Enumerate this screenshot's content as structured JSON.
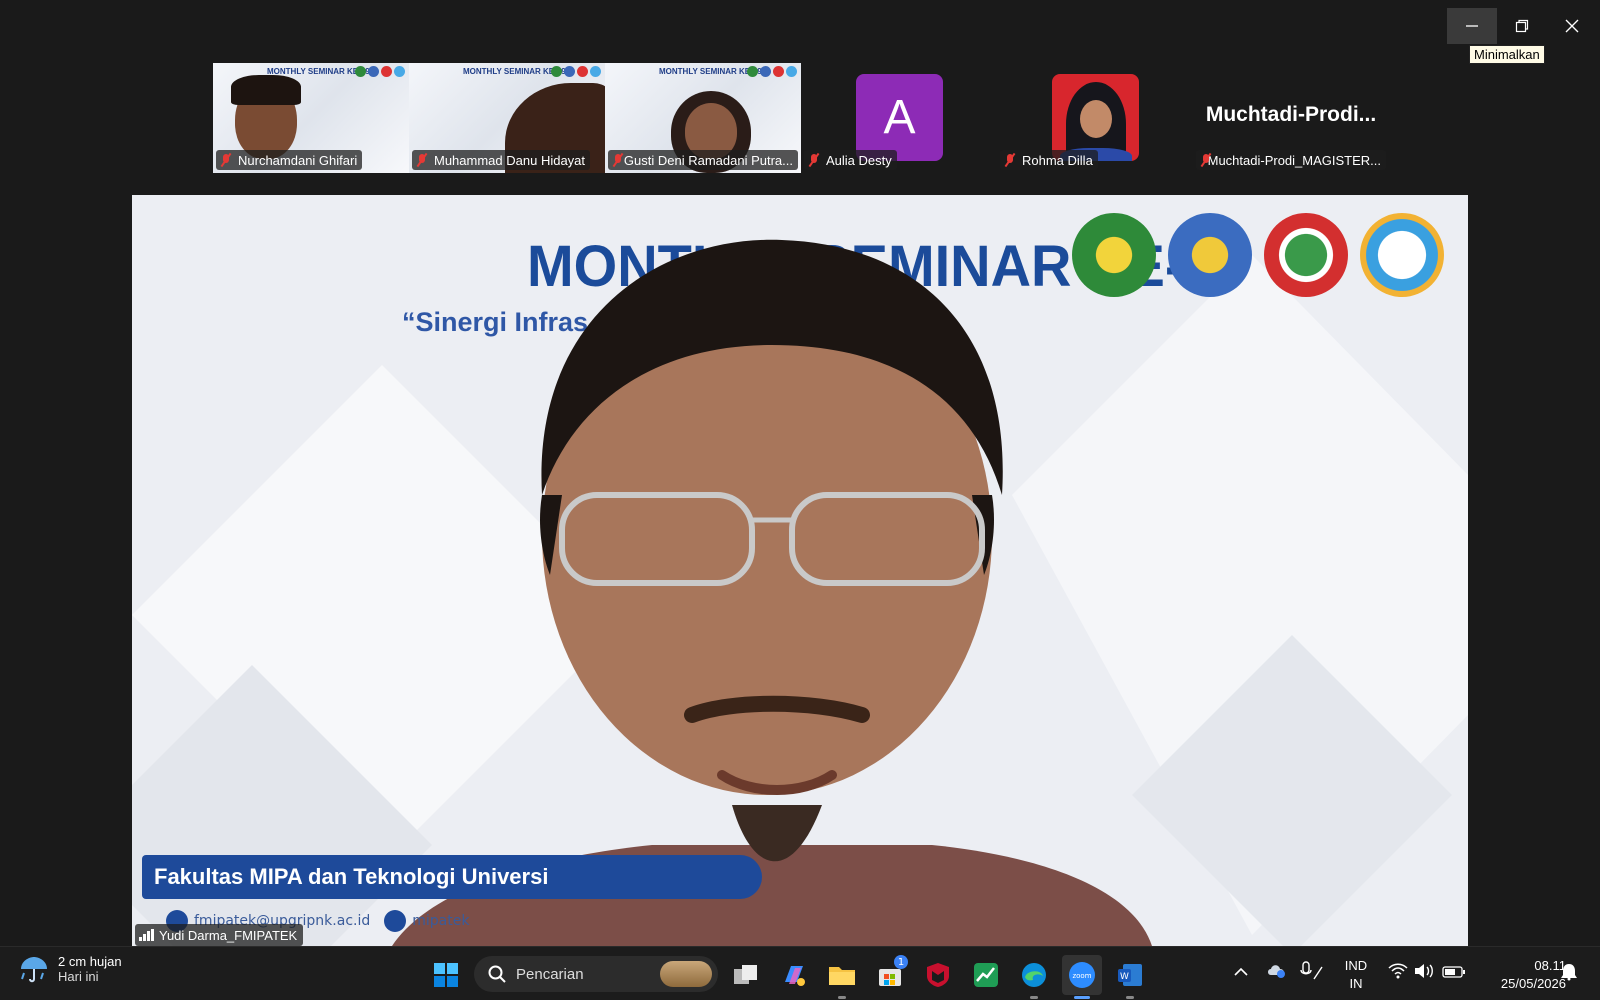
{
  "window": {
    "controls": {
      "minimize": "minimize-icon",
      "restore": "restore-icon",
      "close": "close-icon"
    },
    "tooltip": "Minimalkan"
  },
  "participants": [
    {
      "name": "Nurchamdani Ghifari",
      "type": "video",
      "muted": true
    },
    {
      "name": "Muhammad Danu Hidayat",
      "type": "video",
      "muted": true
    },
    {
      "name": "Gusti Deni Ramadani Putra...",
      "type": "video",
      "muted": true
    },
    {
      "name": "Aulia Desty",
      "type": "avatar",
      "initial": "A",
      "avatar_color": "#8d2bb6",
      "muted": true
    },
    {
      "name": "Rohma Dilla",
      "type": "photo",
      "muted": true
    },
    {
      "name": "Muchtadi-Prodi_MAGISTER...",
      "type": "name",
      "display_name": "Muchtadi-Prodi...",
      "muted": true
    }
  ],
  "mini_slide": {
    "title": "MONTHLY SEMINAR KE-39",
    "subtitle": "\"Sinergi Infrastruktur dan Teknologi dalam Mendukung Pembangunan Berkelanjutan\""
  },
  "main_video": {
    "slide_title": "MONTHLY SEMINAR KE-39",
    "slide_subtitle": "“Sinergi Infras                                        am Mendukung",
    "banner": "Fakultas MIPA dan Teknologi Universi",
    "contact_email": "fmipatek@upgripnk.ac.id",
    "contact_web": "mipatek",
    "speaker_name": "Yudi Darma_FMIPATEK",
    "brand_color": "#1b4b9a"
  },
  "taskbar": {
    "weather_temp": "2 cm hujan",
    "weather_desc": "Hari ini",
    "search_placeholder": "Pencarian",
    "store_badge": "1",
    "lang_1": "IND",
    "lang_2": "IN",
    "time": "08.11",
    "date": "25/05/2026"
  }
}
